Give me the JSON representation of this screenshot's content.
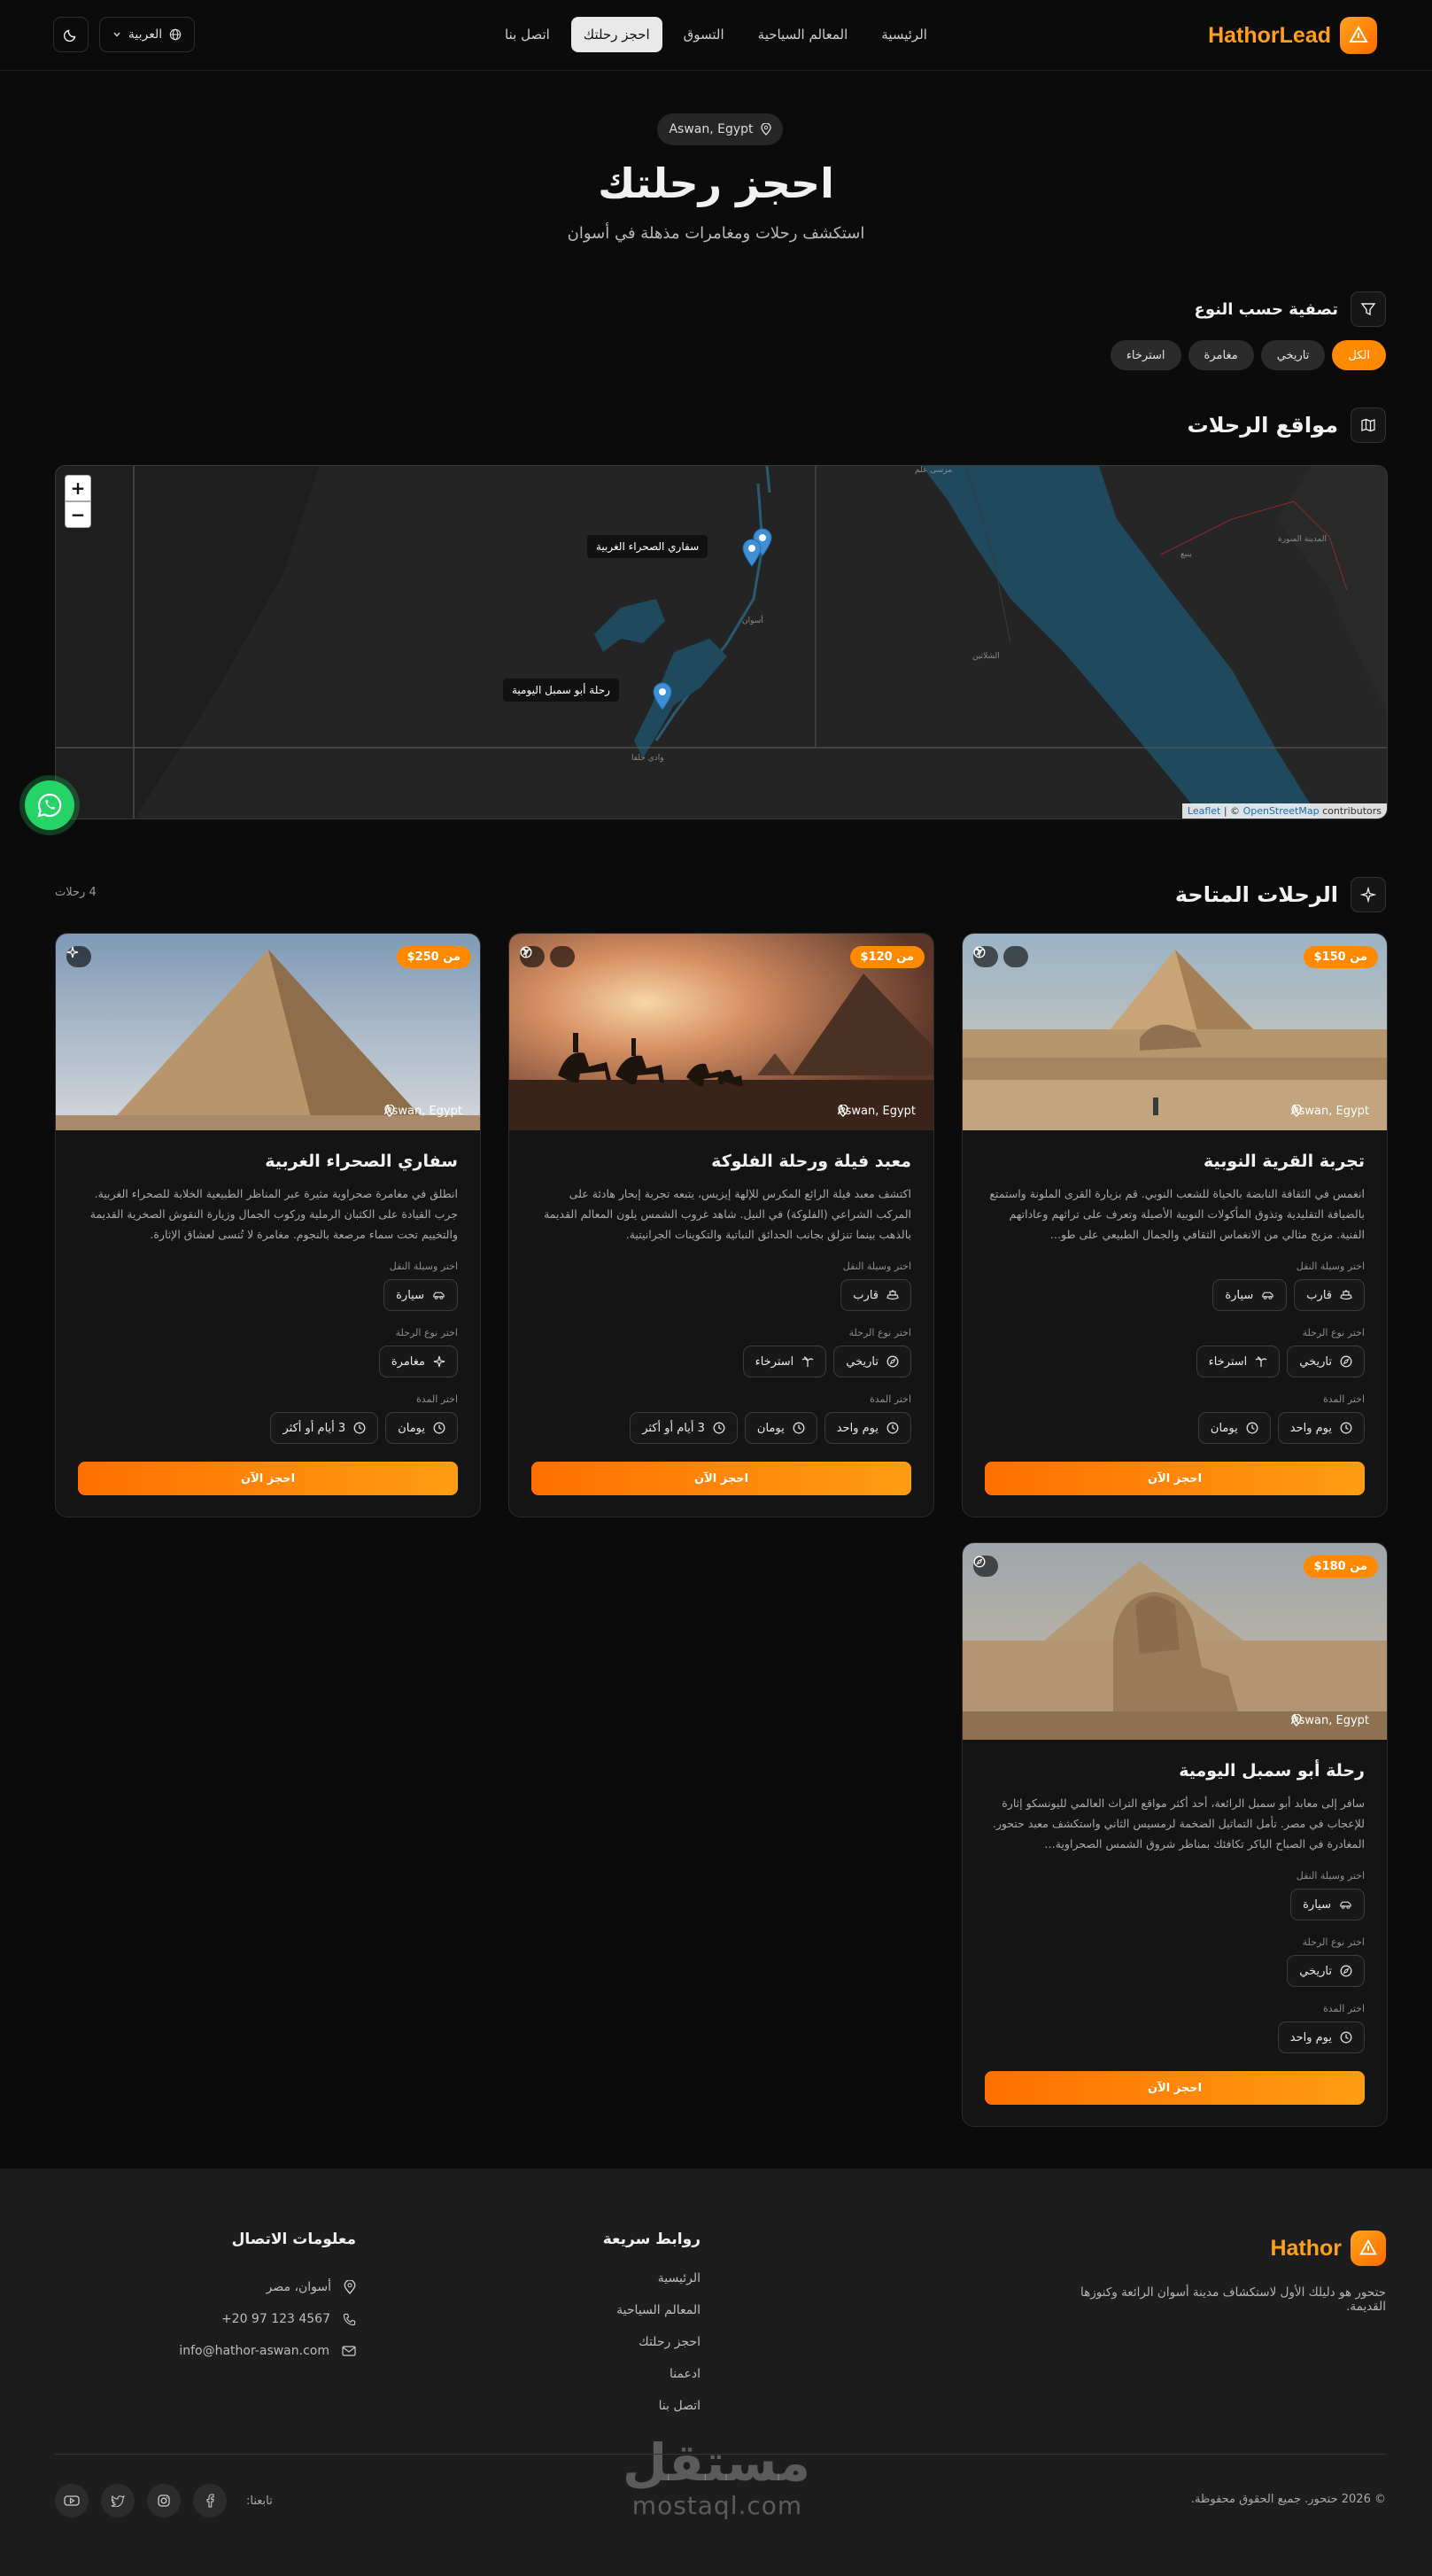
{
  "brand": {
    "name": "HathorLead",
    "accent": "#ff8a00"
  },
  "nav": {
    "items": [
      "الرئيسية",
      "المعالم السياحية",
      "التسوق",
      "احجز رحلتك",
      "اتصل بنا"
    ],
    "active_index": 3
  },
  "language": {
    "label": "العربية"
  },
  "hero": {
    "location": "Aswan, Egypt",
    "title": "احجز رحلتك",
    "subtitle": "استكشف رحلات ومغامرات مذهلة في أسوان"
  },
  "filter": {
    "title": "تصفية حسب النوع",
    "chips": [
      "الكل",
      "تاريخي",
      "مغامرة",
      "استرخاء"
    ],
    "active_index": 0
  },
  "map": {
    "title": "مواقع الرحلات",
    "zoom_in": "+",
    "zoom_out": "−",
    "tooltips": [
      "سفاري الصحراء الغربية",
      "رحلة أبو سمبل اليومية"
    ],
    "attribution": {
      "leaflet": "Leaflet",
      "sep": "| ©",
      "osm": "OpenStreetMap",
      "rest": "contributors"
    },
    "place_labels": [
      "أسوان",
      "الشلاتين",
      "وادي حلفا",
      "المدينة المنورة",
      "ينبع",
      "مرسى علم"
    ]
  },
  "trips": {
    "title": "الرحلات المتاحة",
    "count": "4 رحلات",
    "labels": {
      "transport": "اختر وسيلة النقل",
      "type": "اختر نوع الرحلة",
      "duration": "اختر المدة",
      "book": "احجز الآن"
    },
    "cards": [
      {
        "price": "من 150$",
        "location": "Aswan, Egypt",
        "title": "تجربة القرية النوبية",
        "desc": "انغمس في الثقافة النابضة بالحياة للشعب النوبي. قم بزيارة القرى الملونة واستمتع بالضيافة التقليدية وتذوق المأكولات النوبية الأصيلة وتعرف على تراثهم وعاداتهم الفنية. مزيج مثالي من الانغماس الثقافي والجمال الطبيعي على طو…",
        "transport": [
          "قارب",
          "سيارة"
        ],
        "types": [
          "تاريخي",
          "استرخاء"
        ],
        "durations": [
          "يوم واحد",
          "يومان"
        ]
      },
      {
        "price": "من 120$",
        "location": "Aswan, Egypt",
        "title": "معبد فيلة ورحلة الفلوكة",
        "desc": "اكتشف معبد فيلة الرائع المكرس للإلهة إيزيس، يتبعه تجربة إبحار هادئة على المركب الشراعي (الفلوكة) في النيل. شاهد غروب الشمس يلون المعالم القديمة بالذهب بينما تنزلق بجانب الحدائق النباتية والتكوينات الجرانيتية.",
        "transport": [
          "قارب"
        ],
        "types": [
          "تاريخي",
          "استرخاء"
        ],
        "durations": [
          "يوم واحد",
          "يومان",
          "3 أيام أو أكثر"
        ]
      },
      {
        "price": "من 250$",
        "location": "Aswan, Egypt",
        "title": "سفاري الصحراء الغربية",
        "desc": "انطلق في مغامرة صحراوية مثيرة عبر المناظر الطبيعية الخلابة للصحراء الغربية. جرب القيادة على الكثبان الرملية وركوب الجمال وزيارة النقوش الصخرية القديمة والتخييم تحت سماء مرصعة بالنجوم. مغامرة لا تُنسى لعشاق الإثارة.",
        "transport": [
          "سيارة"
        ],
        "types": [
          "مغامرة"
        ],
        "durations": [
          "يومان",
          "3 أيام أو أكثر"
        ]
      },
      {
        "price": "من 180$",
        "location": "Aswan, Egypt",
        "title": "رحلة أبو سمبل اليومية",
        "desc": "سافر إلى معابد أبو سمبل الرائعة، أحد أكثر مواقع التراث العالمي لليونسكو إثارة للإعجاب في مصر. تأمل التماثيل الضخمة لرمسيس الثاني واستكشف معبد حتحور. المغادرة في الصباح الباكر تكافئك بمناظر شروق الشمس الصحراوية…",
        "transport": [
          "سيارة"
        ],
        "types": [
          "تاريخي"
        ],
        "durations": [
          "يوم واحد"
        ]
      }
    ]
  },
  "footer": {
    "brand": "Hathor",
    "tagline": "حتحور هو دليلك الأول لاستكشاف مدينة أسوان الرائعة وكنوزها القديمة.",
    "quick_title": "روابط سريعة",
    "quick_links": [
      "الرئيسية",
      "المعالم السياحية",
      "احجز رحلتك",
      "ادعمنا",
      "اتصل بنا"
    ],
    "contact_title": "معلومات الاتصال",
    "address": "أسوان، مصر",
    "phone": "+20 97 123 4567",
    "email": "info@hathor-aswan.com",
    "copyright": "© 2026 حتحور. جميع الحقوق محفوظة.",
    "follow": "تابعنا:",
    "watermark_ar": "مستقل",
    "watermark_en": "mostaql.com"
  }
}
